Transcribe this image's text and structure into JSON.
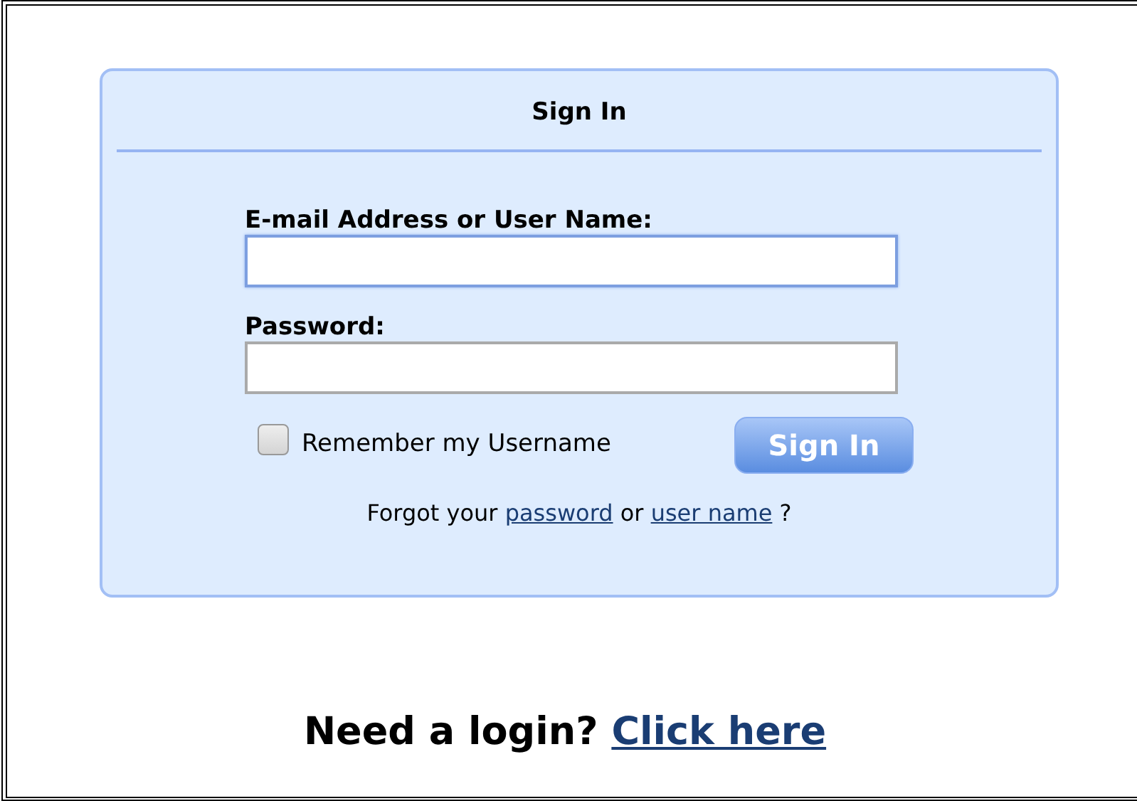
{
  "panel": {
    "title": "Sign In"
  },
  "fields": [
    {
      "label": "E-mail Address or User Name:",
      "focused": true
    },
    {
      "label": "Password:",
      "focused": false
    }
  ],
  "remember": {
    "label": "Remember my Username",
    "checked": false
  },
  "submit": {
    "label": "Sign In"
  },
  "forgot": {
    "before": "Forgot your",
    "password_link": "password",
    "middle": "or",
    "username_link": "user name",
    "after": "?"
  },
  "signup": {
    "text": "Need a login?",
    "link": "Click here"
  }
}
